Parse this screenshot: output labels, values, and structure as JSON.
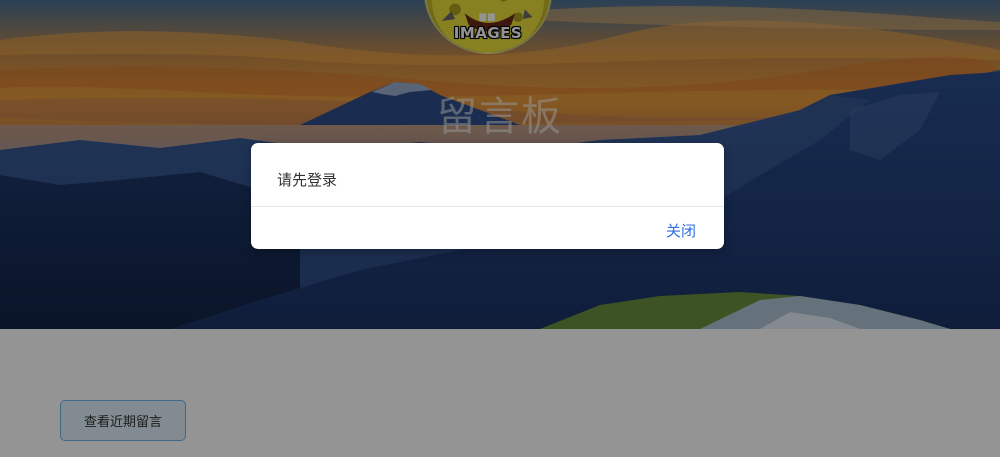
{
  "header": {
    "avatar_caption": "IMAGES",
    "site_title": "留言板"
  },
  "main": {
    "recent_messages_button": "查看近期留言"
  },
  "dialog": {
    "message": "请先登录",
    "close_label": "关闭"
  },
  "colors": {
    "link_blue": "#2f6fe0",
    "button_border": "#6fb6e6",
    "button_bg": "#dff0fa"
  }
}
